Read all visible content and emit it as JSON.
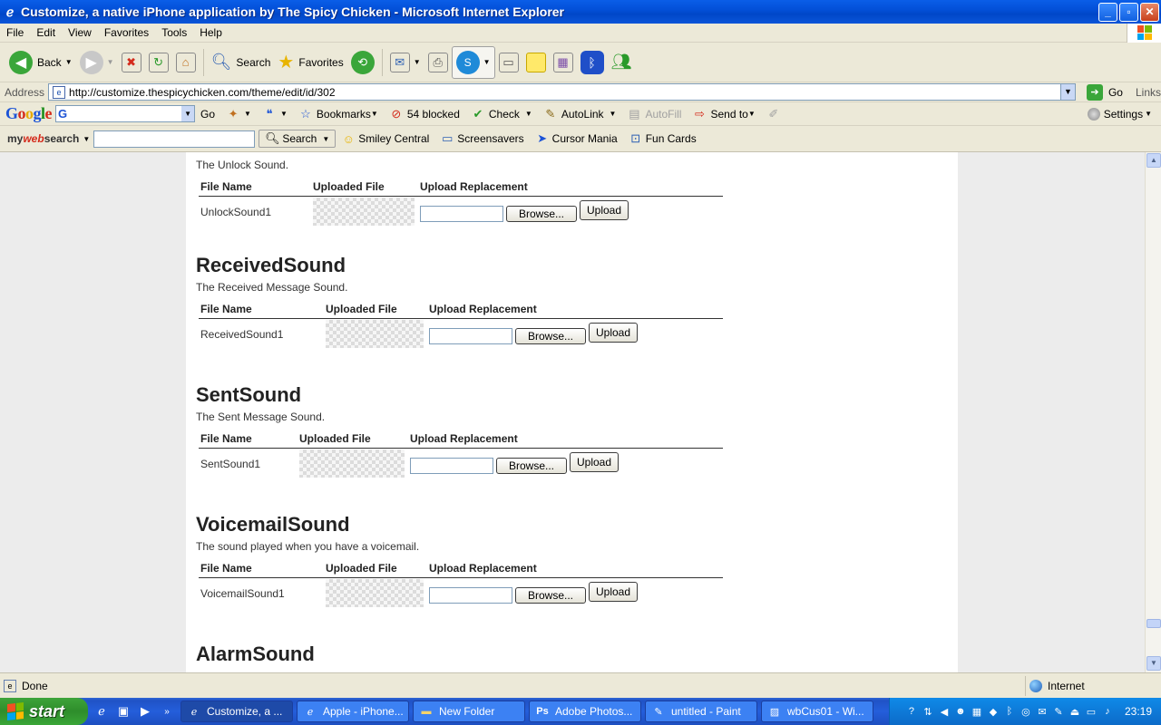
{
  "window": {
    "title": "Customize, a native iPhone application by The Spicy Chicken - Microsoft Internet Explorer",
    "minimize": "_",
    "maximize": "▫",
    "close": "✕"
  },
  "menu": [
    "File",
    "Edit",
    "View",
    "Favorites",
    "Tools",
    "Help"
  ],
  "toolbar": {
    "back_label": "Back",
    "search_label": "Search",
    "favorites_label": "Favorites"
  },
  "address": {
    "label": "Address",
    "url": "http://customize.thespicychicken.com/theme/edit/id/302",
    "go_label": "Go",
    "links_label": "Links"
  },
  "google_toolbar": {
    "go_label": "Go",
    "bookmarks_label": "Bookmarks",
    "blocked_label": "54 blocked",
    "check_label": "Check",
    "autolink_label": "AutoLink",
    "autofill_label": "AutoFill",
    "sendto_label": "Send to",
    "settings_label": "Settings"
  },
  "websearch_toolbar": {
    "brand_my": "my",
    "brand_web": "web",
    "brand_search": "search",
    "search_label": "Search",
    "smiley_label": "Smiley Central",
    "screensavers_label": "Screensavers",
    "cursor_label": "Cursor Mania",
    "funcards_label": "Fun Cards"
  },
  "table_headers": {
    "file_name": "File Name",
    "uploaded_file": "Uploaded File",
    "upload_replacement": "Upload Replacement"
  },
  "buttons": {
    "browse": "Browse...",
    "upload": "Upload"
  },
  "sections": [
    {
      "title": "",
      "description": "The Unlock Sound.",
      "file_name": "UnlockSound1"
    },
    {
      "title": "ReceivedSound",
      "description": "The Received Message Sound.",
      "file_name": "ReceivedSound1"
    },
    {
      "title": "SentSound",
      "description": "The Sent Message Sound.",
      "file_name": "SentSound1"
    },
    {
      "title": "VoicemailSound",
      "description": "The sound played when you have a voicemail.",
      "file_name": "VoicemailSound1"
    },
    {
      "title": "AlarmSound"
    }
  ],
  "status": {
    "text": "Done",
    "zone": "Internet"
  },
  "taskbar": {
    "start_label": "start",
    "tasks": [
      "Customize, a ...",
      "Apple - iPhone...",
      "New Folder",
      "Adobe Photos...",
      "untitled - Paint",
      "wbCus01 - Wi..."
    ],
    "clock": "23:19"
  }
}
